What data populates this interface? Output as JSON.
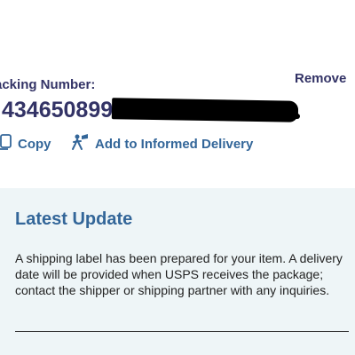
{
  "tracking": {
    "label": "acking Number:",
    "number_visible": "434650899",
    "remove_label": "Remove"
  },
  "actions": {
    "copy_label": "Copy",
    "informed_delivery_label": "Add to Informed Delivery"
  },
  "latest_update": {
    "title": "Latest Update",
    "body": "A shipping label has been prepared for your item. A delivery date will be provided when USPS receives the package; contact the shipper or shipping partner with any inquiries."
  },
  "colors": {
    "navy": "#333366",
    "link_blue": "#336699",
    "update_bg": "#eef5f7"
  },
  "icons": {
    "copy": "copy-icon",
    "informed_delivery": "informed-delivery-icon"
  }
}
